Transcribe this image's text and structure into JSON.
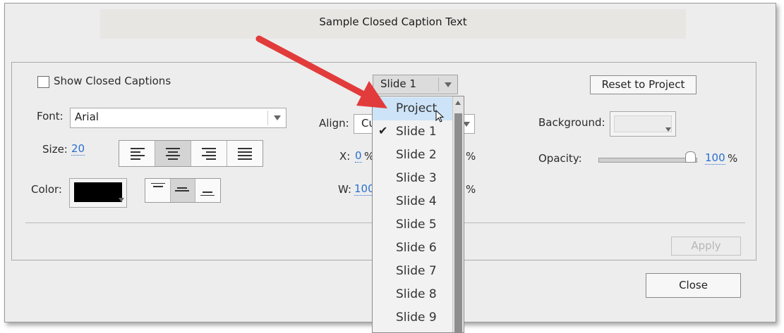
{
  "preview": {
    "caption": "Sample Closed Caption Text"
  },
  "settings": {
    "show_cc_label": "Show Closed Captions",
    "font_label": "Font:",
    "font_value": "Arial",
    "size_label": "Size:",
    "size_value": "20",
    "color_label": "Color:",
    "color_value": "#000000",
    "align_label": "Align:",
    "align_value": "Cu",
    "x_label": "X:",
    "x_value": "0",
    "x_unit": "%",
    "x_unit_right": "%",
    "w_label": "W:",
    "w_value": "100",
    "w_unit_right": "%",
    "background_label": "Background:",
    "opacity_label": "Opacity:",
    "opacity_value": "100",
    "opacity_unit": "%",
    "opacity_level_percent": 100,
    "scope_value": "Slide 1",
    "reset_label": "Reset to Project",
    "apply_label": "Apply",
    "close_label": "Close"
  },
  "dropdown": {
    "items": [
      "Project",
      "Slide 1",
      "Slide 2",
      "Slide 3",
      "Slide 4",
      "Slide 5",
      "Slide 6",
      "Slide 7",
      "Slide 8",
      "Slide 9"
    ],
    "hovered": "Project",
    "checked": "Slide 1"
  },
  "icons": [
    "checkbox-icon",
    "chevron-down-icon",
    "align-left-icon",
    "align-center-icon",
    "align-right-icon",
    "align-justify-icon",
    "valign-top-icon",
    "valign-middle-icon",
    "valign-bottom-icon",
    "checkmark-icon",
    "cursor-icon",
    "red-arrow-annotation"
  ],
  "colors": {
    "accent_link": "#2a6fcf",
    "annotation_arrow": "#e23b3b",
    "hover_item": "#cde3f7"
  }
}
